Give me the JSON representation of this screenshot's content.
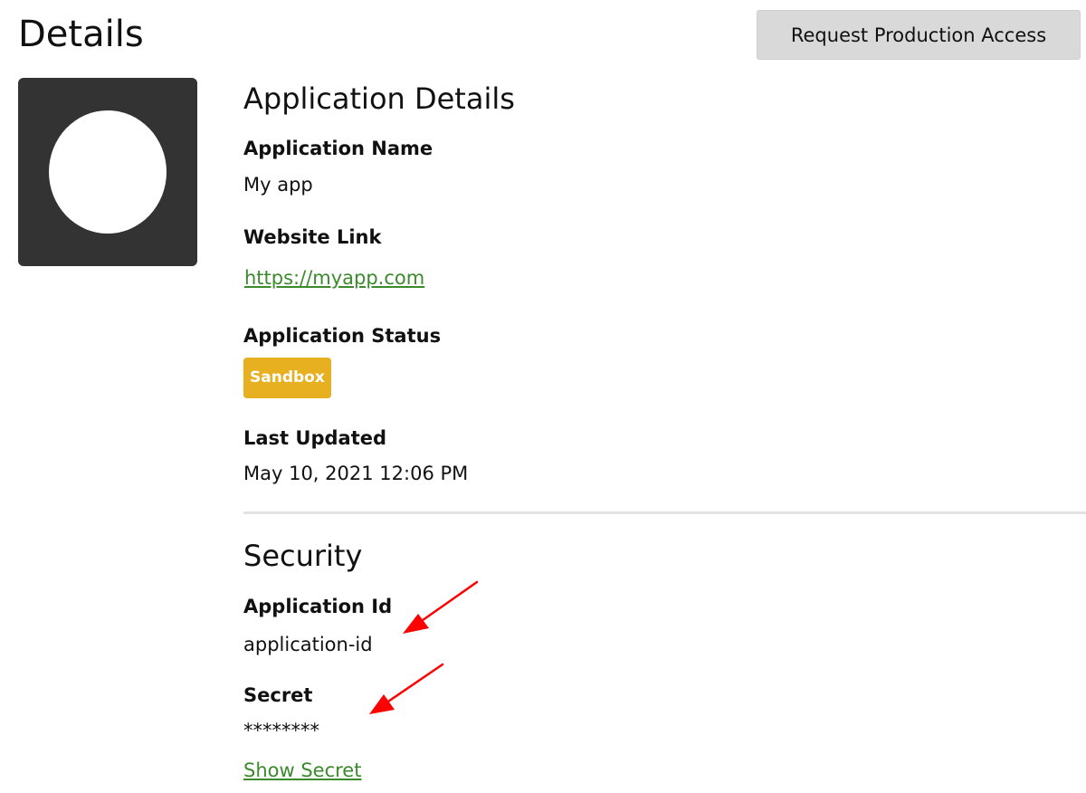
{
  "header": {
    "title": "Details",
    "request_button": "Request Production Access"
  },
  "avatar": {
    "icon": "app-logo-placeholder"
  },
  "application_details": {
    "heading": "Application Details",
    "name_label": "Application Name",
    "name_value": "My app",
    "website_label": "Website Link",
    "website_value": "https://myapp.com",
    "status_label": "Application Status",
    "status_value": "Sandbox",
    "updated_label": "Last Updated",
    "updated_value": "May 10, 2021 12:06 PM"
  },
  "security": {
    "heading": "Security",
    "app_id_label": "Application Id",
    "app_id_value": "application-id",
    "secret_label": "Secret",
    "secret_value": "********",
    "show_secret_link": "Show Secret"
  },
  "colors": {
    "link": "#3b8a2c",
    "badge_sandbox": "#e6b020",
    "button_bg": "#d9d9d9",
    "avatar_bg": "#333333",
    "annotation_arrow": "#ff0000"
  },
  "annotations": {
    "arrows": [
      "arrow-to-application-id",
      "arrow-to-secret"
    ]
  }
}
